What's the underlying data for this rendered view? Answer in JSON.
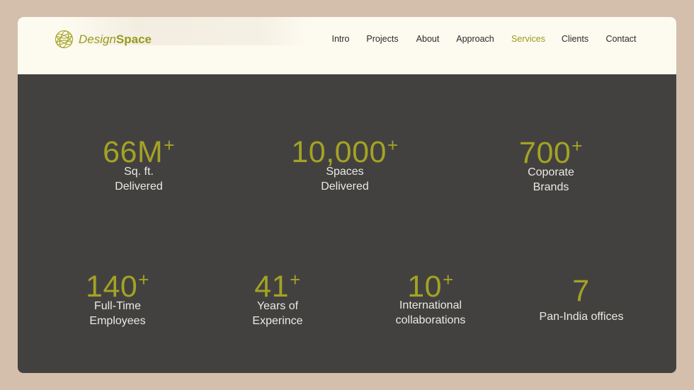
{
  "brand": {
    "name_light": "Design",
    "name_bold": "Space",
    "logo_icon": "globe-mesh-icon",
    "accent_color": "#9a9a1e"
  },
  "nav": {
    "items": [
      {
        "label": "Intro",
        "active": false
      },
      {
        "label": "Projects",
        "active": false
      },
      {
        "label": "About",
        "active": false
      },
      {
        "label": "Approach",
        "active": false
      },
      {
        "label": "Services",
        "active": true
      },
      {
        "label": "Clients",
        "active": false
      },
      {
        "label": "Contact",
        "active": false
      }
    ]
  },
  "stats": [
    {
      "value": "66M",
      "suffix": "+",
      "label_lines": [
        "Sq. ft.",
        "Delivered"
      ]
    },
    {
      "value": "10,000",
      "suffix": "+",
      "label_lines": [
        "Spaces",
        "Delivered"
      ]
    },
    {
      "value": "700",
      "suffix": "+",
      "label_lines": [
        "Coporate",
        "Brands"
      ]
    },
    {
      "value": "140",
      "suffix": "+",
      "label_lines": [
        "Full-Time",
        "Employees"
      ]
    },
    {
      "value": "41",
      "suffix": "+",
      "label_lines": [
        "Years of",
        "Experince"
      ]
    },
    {
      "value": "10",
      "suffix": "+",
      "label_lines": [
        "International",
        "collaborations"
      ]
    },
    {
      "value": "7",
      "suffix": "",
      "label_lines": [
        "Pan-India offices"
      ]
    }
  ],
  "colors": {
    "page_bg": "#d3bfab",
    "header_bg": "#fdfaf0",
    "panel_bg": "#434140",
    "number_color": "#a3a324",
    "label_color": "#ece9e2"
  }
}
